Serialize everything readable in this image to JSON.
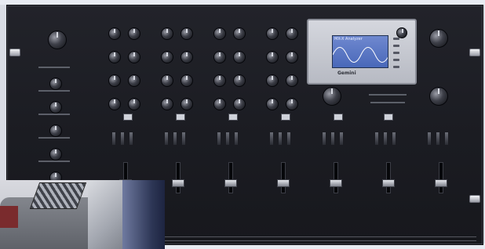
{
  "image": {
    "description_tags": [
      "rack-mount DJ mixer",
      "color screen",
      "photo inset"
    ]
  },
  "device": {
    "display": {
      "header_text": "MX-X Analyzer",
      "brand_text": "Gemini"
    }
  }
}
